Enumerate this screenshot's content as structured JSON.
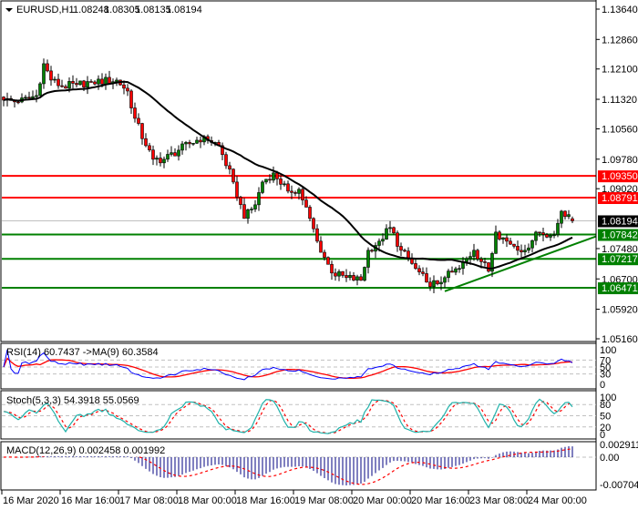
{
  "chart_data": {
    "type": "candlestick",
    "header": {
      "symbol_timeframe": "EURUSD,H1",
      "open": "1.08248",
      "high": "1.08305",
      "low": "1.08135",
      "close": "1.08194"
    },
    "price_axis": {
      "ylim": [
        1.0516,
        1.1364
      ],
      "ticks": [
        "1.13640",
        "1.12860",
        "1.12100",
        "1.11320",
        "1.10560",
        "1.09780",
        "1.09020",
        "1.07480",
        "1.06700",
        "1.05920",
        "1.05160"
      ]
    },
    "levels": [
      {
        "value": "1.09350",
        "color": "#ff0000"
      },
      {
        "value": "1.08791",
        "color": "#ff0000"
      },
      {
        "value": "1.07842",
        "color": "#008000"
      },
      {
        "value": "1.07217",
        "color": "#008000"
      },
      {
        "value": "1.06471",
        "color": "#008000"
      }
    ],
    "current_price": {
      "value": "1.08194",
      "color": "#000000"
    },
    "time_axis": {
      "labels": [
        "16 Mar 2020",
        "16 Mar 16:00",
        "17 Mar 08:00",
        "18 Mar 00:00",
        "18 Mar 16:00",
        "19 Mar 08:00",
        "20 Mar 00:00",
        "20 Mar 16:00",
        "23 Mar 08:00",
        "24 Mar 00:00"
      ],
      "label_bar_index": [
        0,
        16,
        32,
        48,
        64,
        80,
        96,
        112,
        128,
        144
      ]
    },
    "close_keypoints": {
      "bar": [
        0,
        4,
        9,
        11,
        13,
        16,
        20,
        24,
        31,
        34,
        36,
        39,
        41,
        44,
        48,
        51,
        55,
        59,
        63,
        66,
        69,
        71,
        74,
        78,
        81,
        84,
        86,
        90,
        94,
        98,
        100,
        103,
        106,
        109,
        113,
        116,
        119,
        121,
        125,
        129,
        133,
        135,
        138,
        143,
        146,
        151,
        153,
        154,
        156
      ],
      "close": [
        1.11299,
        1.11252,
        1.11416,
        1.12236,
        1.11814,
        1.1165,
        1.11697,
        1.11767,
        1.11814,
        1.11533,
        1.10831,
        1.10129,
        1.09778,
        1.09778,
        1.10012,
        1.10176,
        1.10363,
        1.10129,
        1.09192,
        1.08256,
        1.08607,
        1.09192,
        1.09427,
        1.08958,
        1.09005,
        1.08256,
        1.07671,
        1.06852,
        1.06734,
        1.06664,
        1.07437,
        1.07671,
        1.08022,
        1.07437,
        1.06969,
        1.06618,
        1.06571,
        1.06734,
        1.06969,
        1.07437,
        1.06898,
        1.07905,
        1.07671,
        1.07437,
        1.07905,
        1.07835,
        1.08443,
        1.08303,
        1.08194
      ]
    },
    "moving_average": {
      "color": "#000000"
    },
    "trendline": {
      "color": "#008000",
      "from": {
        "bar": 121,
        "price": 1.06383
      },
      "to": {
        "bar": 163,
        "price": 1.07811
      }
    },
    "candle_colors": {
      "bull": "#008000",
      "bear": "#ff0000"
    },
    "indicators": {
      "rsi": {
        "label": "RSI(14) 60.7437  ->MA(9) 60.3584",
        "value": 60.7437,
        "ma": 60.3584,
        "levels": [
          "100",
          "70",
          "50",
          "30",
          "0"
        ],
        "colors": {
          "rsi": "#0000ff",
          "ma": "#ff0000"
        }
      },
      "stoch": {
        "label": "Stoch(5,3,3) 54.3918 55.0569",
        "k": 54.3918,
        "d": 55.0569,
        "levels": [
          "100",
          "80",
          "50",
          "20",
          "0"
        ],
        "colors": {
          "k": "#20b2aa",
          "d": "#ff0000"
        }
      },
      "macd": {
        "label": "MACD(12,26,9) 0.002458 0.001992",
        "macd": 0.002458,
        "signal": 0.001992,
        "levels": [
          "0.002911",
          "0.00",
          "-0.007046"
        ],
        "colors": {
          "hist": "#000080",
          "signal": "#ff0000"
        }
      }
    }
  }
}
